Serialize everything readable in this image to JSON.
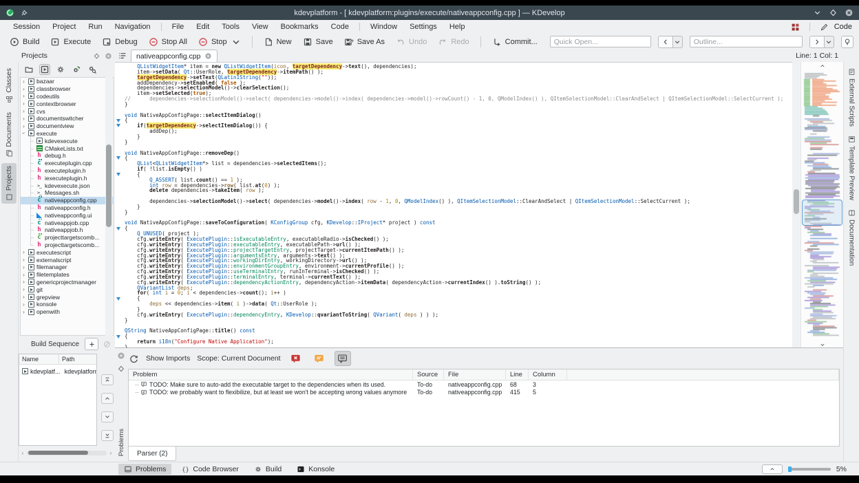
{
  "titlebar": {
    "title": "kdevplatform - [ kdevplatform:plugins/execute/nativeappconfig.cpp ] — KDevelop"
  },
  "menubar": {
    "items": [
      "Session",
      "Project",
      "Run",
      "Navigation",
      "File",
      "Edit",
      "Tools",
      "View",
      "Bookmarks",
      "Code",
      "Window",
      "Settings",
      "Help"
    ],
    "separators_after": [
      3,
      9
    ],
    "right_item": "Code"
  },
  "toolbar": {
    "buttons": [
      {
        "label": "Build",
        "icon": "build"
      },
      {
        "label": "Execute",
        "icon": "execute"
      },
      {
        "label": "Debug",
        "icon": "debug"
      },
      {
        "label": "Stop All",
        "icon": "stop"
      },
      {
        "label": "Stop",
        "icon": "stop",
        "dropdown": true
      },
      {
        "sep": true
      },
      {
        "label": "New",
        "icon": "new-file"
      },
      {
        "label": "Save",
        "icon": "save"
      },
      {
        "label": "Save As",
        "icon": "save-as"
      },
      {
        "label": "Undo",
        "icon": "undo",
        "disabled": true
      },
      {
        "label": "Redo",
        "icon": "redo",
        "disabled": true
      },
      {
        "sep": true
      },
      {
        "label": "Commit...",
        "icon": "commit"
      }
    ],
    "quick_open_placeholder": "Quick Open...",
    "outline_placeholder": "Outline..."
  },
  "tabrow": {
    "panel_title": "Projects",
    "active_tab": "nativeappconfig.cpp",
    "line_col": "Line: 1 Col: 1"
  },
  "left_dock": {
    "tabs": [
      {
        "label": "Classes",
        "icon": "classes",
        "active": false
      },
      {
        "label": "Documents",
        "icon": "documents",
        "active": false
      },
      {
        "label": "Projects",
        "icon": "projects",
        "active": true
      }
    ]
  },
  "right_dock": {
    "tabs": [
      {
        "label": "External Scripts",
        "icon": "ext-scripts"
      },
      {
        "label": "Template Preview",
        "icon": "template"
      },
      {
        "label": "Documentation",
        "icon": "docs"
      }
    ]
  },
  "projects_panel": {
    "tree": [
      {
        "label": "bazaar",
        "icon": "plugin",
        "depth": 1,
        "expander": "closed"
      },
      {
        "label": "classbrowser",
        "icon": "plugin",
        "depth": 1,
        "expander": "closed"
      },
      {
        "label": "codeutils",
        "icon": "plugin",
        "depth": 1,
        "expander": "closed"
      },
      {
        "label": "contextbrowser",
        "icon": "plugin",
        "depth": 1,
        "expander": "closed"
      },
      {
        "label": "cvs",
        "icon": "plugin",
        "depth": 1,
        "expander": "closed"
      },
      {
        "label": "documentswitcher",
        "icon": "plugin",
        "depth": 1,
        "expander": "closed"
      },
      {
        "label": "documentview",
        "icon": "plugin",
        "depth": 1,
        "expander": "closed"
      },
      {
        "label": "execute",
        "icon": "plugin",
        "depth": 1,
        "expander": "open"
      },
      {
        "label": "kdevexecute",
        "icon": "plugin",
        "depth": 2
      },
      {
        "label": "CMakeLists.txt",
        "icon": "cmake",
        "depth": 2
      },
      {
        "label": "debug.h",
        "icon": "header",
        "depth": 2
      },
      {
        "label": "executeplugin.cpp",
        "icon": "cpp",
        "depth": 2
      },
      {
        "label": "executeplugin.h",
        "icon": "header",
        "depth": 2
      },
      {
        "label": "iexecuteplugin.h",
        "icon": "header",
        "depth": 2
      },
      {
        "label": "kdevexecute.json",
        "icon": "script",
        "depth": 2
      },
      {
        "label": "Messages.sh",
        "icon": "script",
        "depth": 2
      },
      {
        "label": "nativeappconfig.cpp",
        "icon": "cpp",
        "depth": 2,
        "selected": true
      },
      {
        "label": "nativeappconfig.h",
        "icon": "header",
        "depth": 2
      },
      {
        "label": "nativeappconfig.ui",
        "icon": "ui",
        "depth": 2
      },
      {
        "label": "nativeappjob.cpp",
        "icon": "cpp",
        "depth": 2
      },
      {
        "label": "nativeappjob.h",
        "icon": "header",
        "depth": 2
      },
      {
        "label": "projecttargetscomb...",
        "icon": "cpp-green",
        "depth": 2
      },
      {
        "label": "projecttargetscomb...",
        "icon": "header",
        "depth": 2,
        "lastchild": true
      },
      {
        "label": "executescript",
        "icon": "plugin",
        "depth": 1,
        "expander": "closed"
      },
      {
        "label": "externalscript",
        "icon": "plugin",
        "depth": 1,
        "expander": "closed"
      },
      {
        "label": "filemanager",
        "icon": "plugin",
        "depth": 1,
        "expander": "closed"
      },
      {
        "label": "filetemplates",
        "icon": "plugin",
        "depth": 1,
        "expander": "closed"
      },
      {
        "label": "genericprojectmanager",
        "icon": "plugin",
        "depth": 1,
        "expander": "closed"
      },
      {
        "label": "git",
        "icon": "plugin",
        "depth": 1,
        "expander": "closed"
      },
      {
        "label": "grepview",
        "icon": "plugin",
        "depth": 1,
        "expander": "closed"
      },
      {
        "label": "konsole",
        "icon": "plugin",
        "depth": 1,
        "expander": "closed"
      },
      {
        "label": "openwith",
        "icon": "plugin",
        "depth": 1,
        "expander": "closed"
      }
    ]
  },
  "build_sequence": {
    "title": "Build Sequence",
    "columns": [
      "Name",
      "Path"
    ],
    "rows": [
      {
        "name": "kdevplatf...",
        "path": "kdevplatform"
      }
    ]
  },
  "editor": {
    "highlight_token": "targetDependency",
    "fold_lines": [
      10,
      11,
      17,
      20,
      30,
      43,
      50
    ],
    "code_lines": [
      "    QListWidgetItem* item = new QListWidgetItem(icon, targetDependency->text(), dependencies);",
      "    item->setData( Qt::UserRole, targetDependency->itemPath() );",
      "    targetDependency->setText(QLatin1String(\"\"));",
      "    addDependency->setEnabled( false );",
      "    dependencies->selectionModel()->clearSelection();",
      "    item->setSelected(true);",
      "//      dependencies->selectionModel()->select( dependencies->model()->index( dependencies->model()->rowCount() - 1, 0, QModelIndex() ), QItemSelectionModel::ClearAndSelect | QItemSelectionModel::SelectCurrent );",
      "}",
      "",
      "void NativeAppConfigPage::selectItemDialog()",
      "{",
      "    if(targetDependency->selectItemDialog()) {",
      "        addDep();",
      "    }",
      "}",
      "",
      "void NativeAppConfigPage::removeDep()",
      "{",
      "    QList<QListWidgetItem*> list = dependencies->selectedItems();",
      "    if( !list.isEmpty() )",
      "    {",
      "        Q_ASSERT( list.count() == 1 );",
      "        int row = dependencies->row( list.at(0) );",
      "        delete dependencies->takeItem( row );",
      "",
      "        dependencies->selectionModel()->select( dependencies->model()->index( row - 1, 0, QModelIndex() ), QItemSelectionModel::ClearAndSelect | QItemSelectionModel::SelectCurrent );",
      "    }",
      "}",
      "",
      "void NativeAppConfigPage::saveToConfiguration( KConfigGroup cfg, KDevelop::IProject* project ) const",
      "{",
      "    Q_UNUSED( project );",
      "    cfg.writeEntry( ExecutePlugin::isExecutableEntry, executableRadio->isChecked() );",
      "    cfg.writeEntry( ExecutePlugin::executableEntry, executablePath->url() );",
      "    cfg.writeEntry( ExecutePlugin::projectTargetEntry, projectTarget->currentItemPath() );",
      "    cfg.writeEntry( ExecutePlugin::argumentsEntry, arguments->text() );",
      "    cfg.writeEntry( ExecutePlugin::workingDirEntry, workingDirectory->url() );",
      "    cfg.writeEntry( ExecutePlugin::environmentGroupEntry, environment->currentProfile() );",
      "    cfg.writeEntry( ExecutePlugin::useTerminalEntry, runInTerminal->isChecked() );",
      "    cfg.writeEntry( ExecutePlugin::terminalEntry, terminal->currentText() );",
      "    cfg.writeEntry( ExecutePlugin::dependencyActionEntry, dependencyAction->itemData( dependencyAction->currentIndex() ).toString() );",
      "    QVariantList deps;",
      "    for( int i = 0; i < dependencies->count(); i++ )",
      "    {",
      "        deps << dependencies->item( i )->data( Qt::UserRole );",
      "    }",
      "    cfg.writeEntry( ExecutePlugin::dependencyEntry, KDevelop::qvariantToString( QVariant( deps ) ) );",
      "}",
      "",
      "QString NativeAppConfigPage::title() const",
      "{",
      "    return i18n(\"Configure Native Application\");",
      "}"
    ]
  },
  "problems_panel": {
    "toolbar": {
      "show_imports": "Show Imports",
      "scope": "Scope: Current Document"
    },
    "columns": [
      "Problem",
      "Source",
      "File",
      "Line",
      "Column"
    ],
    "rows": [
      {
        "problem": "TODO: Make sure to auto-add the executable target to the dependencies when its used.",
        "source": "To-do",
        "file": "nativeappconfig.cpp",
        "line": "68",
        "column": "3"
      },
      {
        "problem": "TODO: we probably want to flexibilize, but at least we won't be accepting wrong values anymore",
        "source": "To-do",
        "file": "nativeappconfig.cpp",
        "line": "415",
        "column": "5"
      }
    ],
    "bottom_tab": "Parser (2)"
  },
  "statusbar": {
    "items": [
      {
        "label": "Problems",
        "icon": "panel",
        "active": true
      },
      {
        "label": "Code Browser",
        "icon": "braces",
        "active": false
      },
      {
        "label": "Build",
        "icon": "gear",
        "active": false
      },
      {
        "label": "Konsole",
        "icon": "terminal",
        "active": false
      }
    ],
    "zoom_value": "5%"
  },
  "colors": {
    "accent": "#3daee9",
    "titlebar": "#3a474f",
    "highlight": "#fbee75"
  }
}
